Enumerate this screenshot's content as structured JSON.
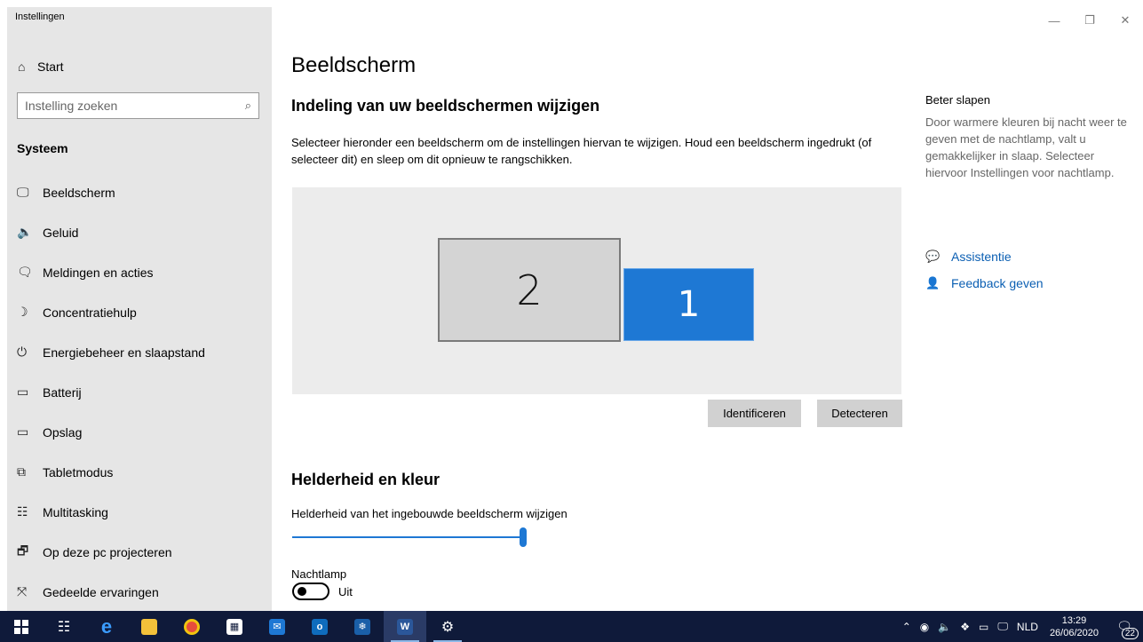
{
  "window": {
    "title": "Instellingen",
    "controls": {
      "minimize": "—",
      "maximize": "❐",
      "close": "✕"
    }
  },
  "sidebar": {
    "start_label": "Start",
    "search_placeholder": "Instelling zoeken",
    "section": "Systeem",
    "items": [
      {
        "label": "Beeldscherm",
        "icon": "monitor-icon",
        "glyph": "🖵"
      },
      {
        "label": "Geluid",
        "icon": "speaker-icon",
        "glyph": "🔈"
      },
      {
        "label": "Meldingen en acties",
        "icon": "notification-icon",
        "glyph": "🗨"
      },
      {
        "label": "Concentratiehulp",
        "icon": "moon-icon",
        "glyph": "☽"
      },
      {
        "label": "Energiebeheer en slaapstand",
        "icon": "power-icon",
        "glyph": "⏻"
      },
      {
        "label": "Batterij",
        "icon": "battery-icon",
        "glyph": "▭"
      },
      {
        "label": "Opslag",
        "icon": "storage-icon",
        "glyph": "▭"
      },
      {
        "label": "Tabletmodus",
        "icon": "tablet-icon",
        "glyph": "⧉"
      },
      {
        "label": "Multitasking",
        "icon": "multitasking-icon",
        "glyph": "☷"
      },
      {
        "label": "Op deze pc projecteren",
        "icon": "project-icon",
        "glyph": "🗗"
      },
      {
        "label": "Gedeelde ervaringen",
        "icon": "shared-icon",
        "glyph": "⤧"
      }
    ]
  },
  "main": {
    "title": "Beeldscherm",
    "layout_heading": "Indeling van uw beeldschermen wijzigen",
    "layout_description": "Selecteer hieronder een beeldscherm om de instellingen hiervan te wijzigen. Houd een beeldscherm ingedrukt (of selecteer dit) en sleep om dit opnieuw te rangschikken.",
    "monitor_2_label": "2",
    "monitor_1_label": "1",
    "identify_button": "Identificeren",
    "detect_button": "Detecteren",
    "brightness_heading": "Helderheid en kleur",
    "brightness_label": "Helderheid van het ingebouwde beeldscherm wijzigen",
    "brightness_value": 1.0,
    "nightlight_label": "Nachtlamp",
    "nightlight_state": "Uit"
  },
  "aside": {
    "title": "Beter slapen",
    "text": "Door warmere kleuren bij nacht weer te geven met de nachtlamp, valt u gemakkelijker in slaap. Selecteer hiervoor Instellingen voor nachtlamp.",
    "link_help": "Assistentie",
    "link_feedback": "Feedback geven"
  },
  "taskbar": {
    "language": "NLD",
    "time": "13:29",
    "date": "26/06/2020",
    "notification_count": "22"
  },
  "colors": {
    "accent": "#1e78d4",
    "sidebar_bg": "#e6e6e6",
    "taskbar_bg": "#0f1a3a"
  }
}
